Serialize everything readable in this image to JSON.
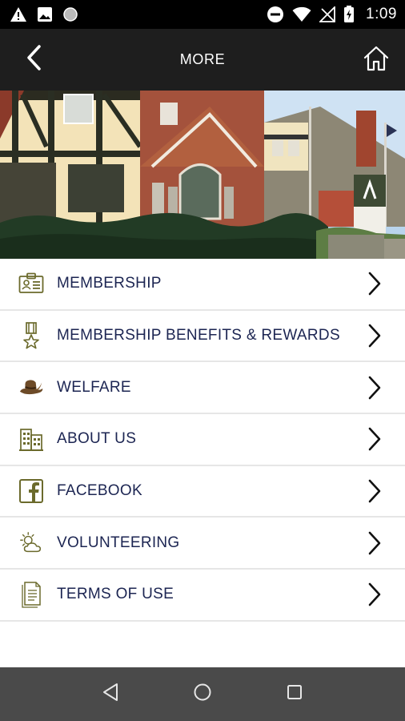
{
  "status_bar": {
    "time": "1:09",
    "icons": [
      "warning-icon",
      "image-icon",
      "circle-icon",
      "do-not-disturb-icon",
      "wifi-icon",
      "no-signal-icon",
      "battery-icon"
    ]
  },
  "header": {
    "title": "MORE",
    "back_icon": "chevron-left-icon",
    "home_icon": "home-icon"
  },
  "hero": {
    "description_icon": "building-photo"
  },
  "menu": {
    "items": [
      {
        "label": "MEMBERSHIP",
        "icon": "id-card-icon"
      },
      {
        "label": "MEMBERSHIP BENEFITS & REWARDS",
        "icon": "medal-icon"
      },
      {
        "label": "WELFARE",
        "icon": "slouch-hat-icon"
      },
      {
        "label": "ABOUT US",
        "icon": "buildings-icon"
      },
      {
        "label": "FACEBOOK",
        "icon": "facebook-icon"
      },
      {
        "label": "VOLUNTEERING",
        "icon": "sun-cloud-icon"
      },
      {
        "label": "TERMS OF USE",
        "icon": "document-icon"
      }
    ]
  },
  "colors": {
    "header_bg": "#1e1e1e",
    "label_text": "#1c2552",
    "icon_olive": "#6b6a2c",
    "nav_bg": "#4a4a4a"
  }
}
